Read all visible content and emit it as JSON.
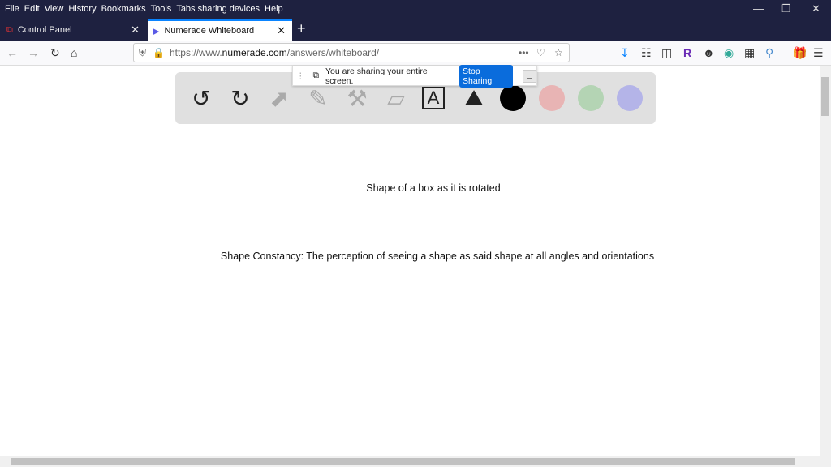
{
  "menu": [
    "File",
    "Edit",
    "View",
    "History",
    "Bookmarks",
    "Tools",
    "Tabs sharing devices",
    "Help"
  ],
  "tabs": [
    {
      "label": "Control Panel"
    },
    {
      "label": "Numerade Whiteboard"
    }
  ],
  "url": {
    "prefix": "https://www.",
    "domain": "numerade.com",
    "path": "/answers/whiteboard/"
  },
  "sharing": {
    "message": "You are sharing your entire screen.",
    "stop_label": "Stop Sharing",
    "minimize": "_"
  },
  "toolbar": {
    "colors": [
      "#000000",
      "#e8b4b4",
      "#b4d4b4",
      "#b4b4e8"
    ]
  },
  "content": {
    "line1": "Shape of a box as it is rotated",
    "line2": "Shape Constancy: The perception of seeing a shape as said shape at all angles and orientations"
  }
}
